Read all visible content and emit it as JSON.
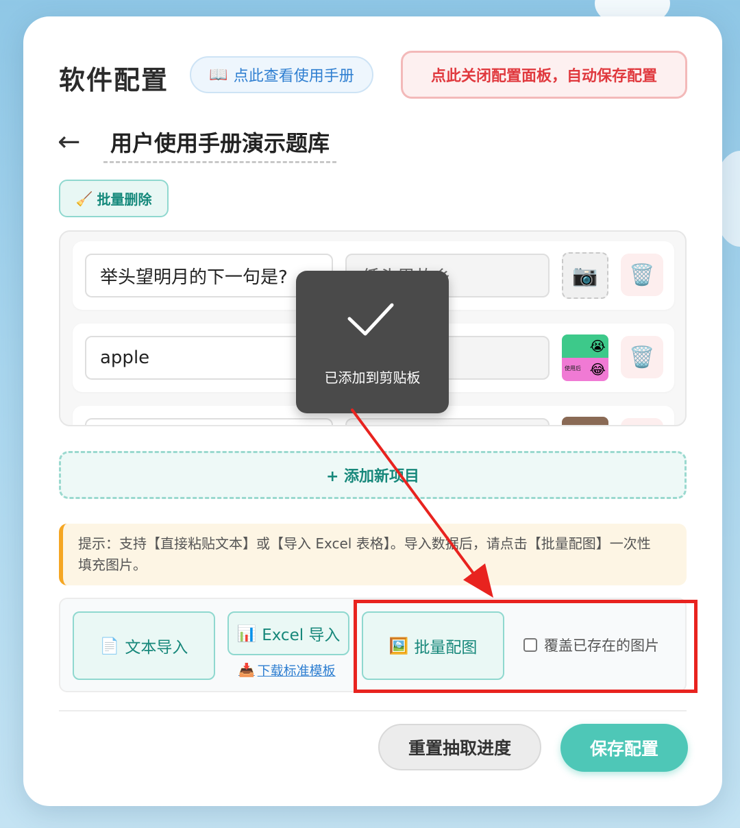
{
  "header": {
    "title": "软件配置",
    "manual_icon": "📖",
    "manual_label": "点此查看使用手册",
    "close_label": "点此关闭配置面板，自动保存配置"
  },
  "bank": {
    "back_arrow": "←",
    "title": "用户使用手册演示题库"
  },
  "batch_delete": {
    "icon": "🧹",
    "label": "批量删除"
  },
  "items": [
    {
      "question": "举头望明月的下一句是?",
      "answer": "低头思故乡",
      "image": "camera-placeholder"
    },
    {
      "question": "apple",
      "answer": "",
      "image": "thumbnail"
    },
    {
      "question": "",
      "answer": "",
      "image": "thumbnail"
    }
  ],
  "icons": {
    "camera": "📷",
    "trash": "🗑️",
    "face_top": "😭",
    "face_bottom": "😂",
    "thumb_label": "使用后"
  },
  "toast": {
    "message": "已添加到剪贴板"
  },
  "add_item": {
    "label": "+ 添加新项目"
  },
  "hint": {
    "text": "提示：支持【直接粘贴文本】或【导入 Excel 表格】。导入数据后，请点击【批量配图】一次性填充图片。"
  },
  "tools": {
    "text_import": {
      "icon": "📄",
      "label": "文本导入"
    },
    "excel_import": {
      "icon": "📊",
      "label": "Excel 导入"
    },
    "download_template": {
      "icon": "📥",
      "label": "下载标准模板"
    },
    "batch_image": {
      "icon": "🖼️",
      "label": "批量配图"
    },
    "overwrite_label": "覆盖已存在的图片"
  },
  "footer": {
    "reset_label": "重置抽取进度",
    "save_label": "保存配置"
  },
  "colors": {
    "accent": "#4ec7b7",
    "danger": "#e0393e",
    "annotation": "#e8231f"
  }
}
